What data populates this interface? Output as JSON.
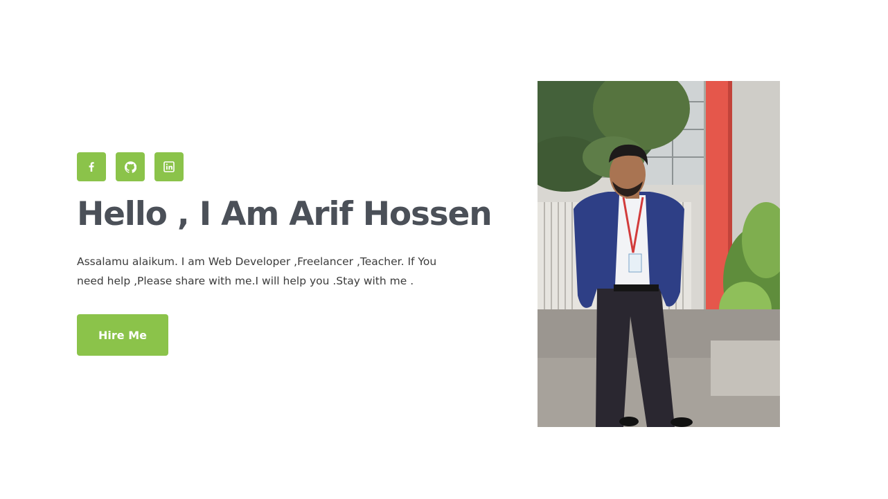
{
  "hero": {
    "socials": [
      {
        "name": "facebook-icon",
        "glyph": "f"
      },
      {
        "name": "github-icon"
      },
      {
        "name": "linkedin-icon"
      }
    ],
    "headline": "Hello , I Am Arif Hossen",
    "intro": "Assalamu alaikum. I am Web Developer ,Freelancer ,Teacher. If You need help ,Please share with me.I will help you .Stay with me .",
    "cta_label": "Hire Me"
  },
  "colors": {
    "accent": "#8bc34a",
    "headline": "#4b5058",
    "body_text": "#3b3b3b",
    "background": "#ffffff"
  }
}
